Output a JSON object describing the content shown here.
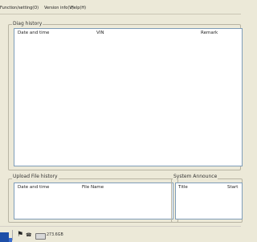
{
  "menu": {
    "items": [
      {
        "label": "Function/setting(O)"
      },
      {
        "label": "Version info(V)"
      },
      {
        "label": "Help(H)"
      }
    ]
  },
  "diag_history": {
    "title": "Diag history",
    "columns": [
      "Date and time",
      "VIN",
      "Remark"
    ],
    "rows": []
  },
  "upload_file_history": {
    "title": "Upload File history",
    "columns": [
      "Date and time",
      "File Name"
    ],
    "rows": []
  },
  "system_announce": {
    "title": "System Announce",
    "columns": [
      "Title",
      "Start"
    ],
    "rows": []
  },
  "taskbar": {
    "drive_text": "273.6GB",
    "icons": [
      "flag-icon",
      "phone-icon",
      "hard-drive-icon"
    ]
  }
}
